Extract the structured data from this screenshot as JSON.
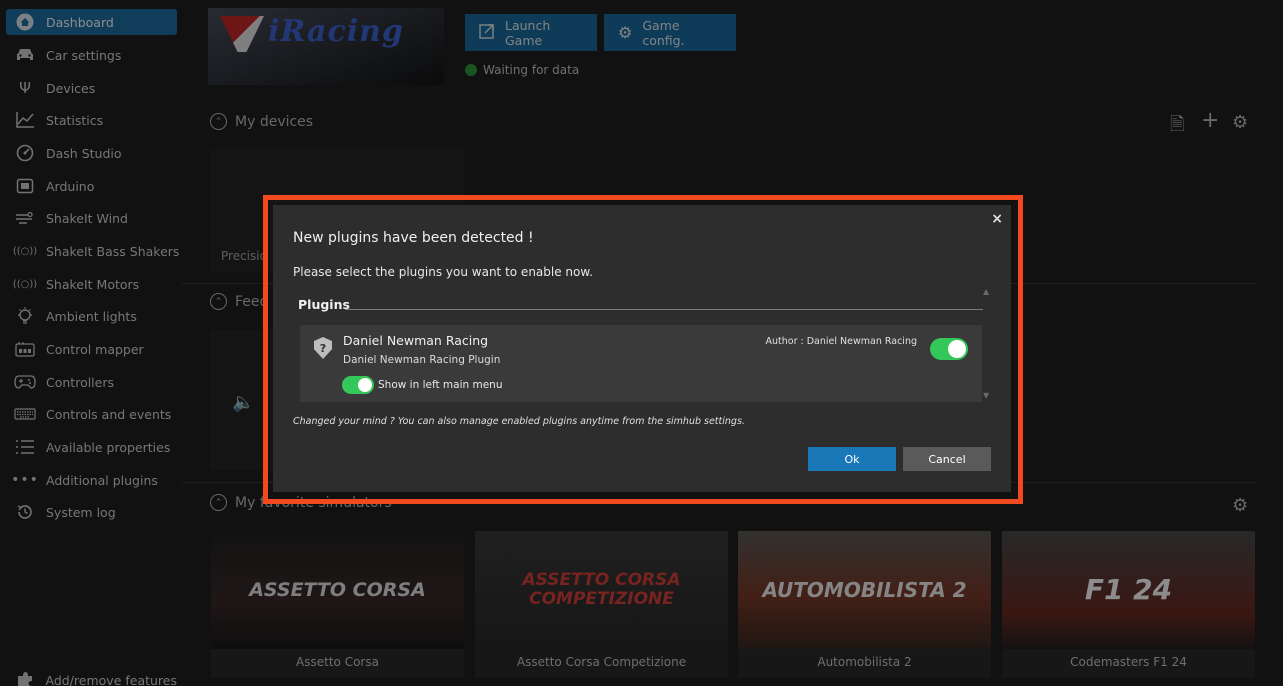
{
  "sidebar": {
    "items": [
      {
        "label": "Dashboard",
        "icon": "home-icon",
        "active": true
      },
      {
        "label": "Car settings",
        "icon": "car-icon"
      },
      {
        "label": "Devices",
        "icon": "usb-icon"
      },
      {
        "label": "Statistics",
        "icon": "chart-line-icon"
      },
      {
        "label": "Dash Studio",
        "icon": "gauge-icon"
      },
      {
        "label": "Arduino",
        "icon": "chip-icon"
      },
      {
        "label": "ShakeIt Wind",
        "icon": "wind-icon"
      },
      {
        "label": "ShakeIt Bass Shakers",
        "icon": "vibration-icon"
      },
      {
        "label": "ShakeIt Motors",
        "icon": "vibration-icon"
      },
      {
        "label": "Ambient lights",
        "icon": "lightbulb-icon"
      },
      {
        "label": "Control mapper",
        "icon": "keypad-icon"
      },
      {
        "label": "Controllers",
        "icon": "gamepad-icon"
      },
      {
        "label": "Controls and events",
        "icon": "keyboard-icon"
      },
      {
        "label": "Available properties",
        "icon": "list-icon"
      },
      {
        "label": "Additional plugins",
        "icon": "dots-icon"
      },
      {
        "label": "System log",
        "icon": "history-icon"
      }
    ],
    "footer": {
      "label": "Add/remove features",
      "icon": "puzzle-icon"
    }
  },
  "header": {
    "game_logo": "iRacing",
    "launch_label": "Launch Game",
    "config_label": "Game config.",
    "status_text": "Waiting for data"
  },
  "sections": {
    "devices_title": "My devices",
    "device_name": "Precisio",
    "feedback_title": "Feed",
    "simulators_title": "My favorite simulators"
  },
  "simulators": [
    {
      "name": "Assetto Corsa",
      "art": "ASSETTO CORSA"
    },
    {
      "name": "Assetto Corsa Competizione",
      "art": "ASSETTO CORSA COMPETIZIONE"
    },
    {
      "name": "Automobilista 2",
      "art": "AUTOMOBILISTA 2"
    },
    {
      "name": "Codemasters F1 24",
      "art": "F1 24"
    }
  ],
  "dialog": {
    "title": "New plugins have been detected !",
    "subtitle": "Please select the plugins you want to enable now.",
    "group_title": "Plugins",
    "plugin": {
      "name": "Daniel Newman Racing",
      "description": "Daniel Newman Racing Plugin",
      "author": "Author : Daniel Newman Racing",
      "enabled": true,
      "show_in_menu_label": "Show in left main menu",
      "show_in_menu": true
    },
    "hint": "Changed your mind ? You can also manage enabled plugins anytime from the simhub settings.",
    "ok_label": "Ok",
    "cancel_label": "Cancel",
    "close_glyph": "×"
  },
  "colors": {
    "accent": "#1b6da0",
    "highlight_border": "#f24a1e",
    "toggle_on": "#34c759",
    "status_green": "#2e9a3c"
  }
}
